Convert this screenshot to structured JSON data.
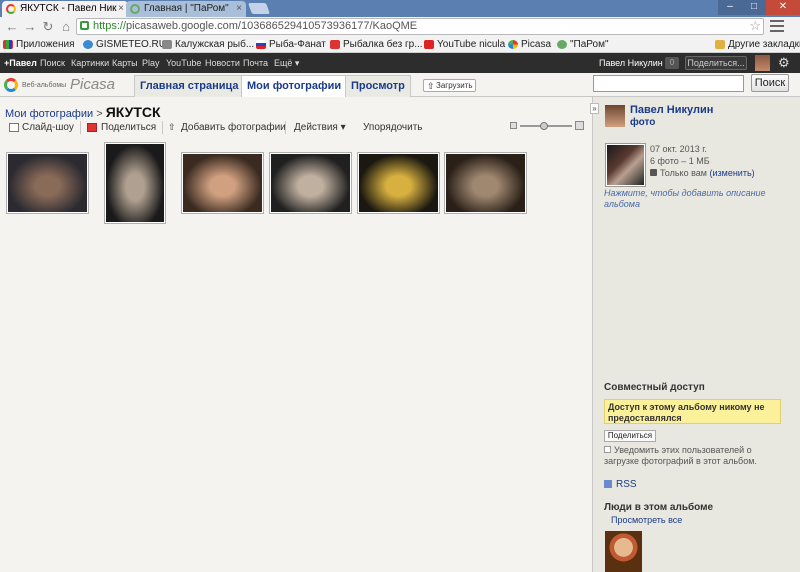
{
  "browser": {
    "tabs": [
      {
        "title": "ЯКУТСК - Павел Ник"
      },
      {
        "title": "Главная | \"ПаРом\""
      }
    ],
    "url_scheme": "https://",
    "url_rest": "picasaweb.google.com/103686529410573936177/KaoQME",
    "bookmarks": [
      "Приложения",
      "GISMETEO.RU:",
      "Калужская рыб...",
      "Рыба-Фанат",
      "Рыбалка без гр...",
      "YouTube nicula",
      "Picasa",
      "\"ПаРом\"",
      "Другие закладки"
    ]
  },
  "gbar": {
    "links": [
      "+Павел",
      "Поиск",
      "Картинки",
      "Карты",
      "Play",
      "YouTube",
      "Новости",
      "Почта",
      "Ещё ▾"
    ],
    "user": "Павел Никулин",
    "count": "0",
    "share": "Поделиться..."
  },
  "app": {
    "logo_sub": "Веб-альбомы",
    "logo_name": "Picasa",
    "tabs": [
      "Главная страница",
      "Мои фотографии",
      "Просмотр"
    ],
    "upload": "Загрузить",
    "search_button": "Поиск"
  },
  "album": {
    "crumb_parent": "Мои фотографии",
    "crumb_sep": ">",
    "title": "ЯКУТСК",
    "actions": [
      "Слайд-шоу",
      "Поделиться",
      "Добавить фотографии",
      "Действия ▾",
      "Упорядочить"
    ],
    "photos": [
      {
        "subject": "person in cape by ice wall",
        "c1": "#2a2a30",
        "c2": "#8a6a58"
      },
      {
        "subject": "woman by ice sculpture",
        "c1": "#1a1a1a",
        "c2": "#b0a090"
      },
      {
        "subject": "ice crystal in hand",
        "c1": "#3a2a20",
        "c2": "#d0a080"
      },
      {
        "subject": "frozen cave ceiling",
        "c1": "#202020",
        "c2": "#c0b0a0"
      },
      {
        "subject": "ice bear sculpture",
        "c1": "#1a1810",
        "c2": "#d8b040"
      },
      {
        "subject": "person on ice sled",
        "c1": "#2a2018",
        "c2": "#a08870"
      }
    ]
  },
  "sidebar": {
    "owner_name": "Павел Никулин",
    "owner_link": "фото",
    "date": "07 окт. 2013 г.",
    "count": "6 фото – 1 МБ",
    "visibility": "Только вам",
    "change_link": "(изменить)",
    "desc_hint": "Нажмите, чтобы добавить описание альбома",
    "share_head": "Совместный доступ",
    "share_warning": "Доступ к этому альбому никому не предоставлялся",
    "share_button": "Поделиться",
    "notify": "Уведомить этих пользователей о загрузке фотографий в этот альбом.",
    "rss": "RSS",
    "people_head": "Люди в этом альбоме",
    "people_link": "Просмотреть все"
  }
}
